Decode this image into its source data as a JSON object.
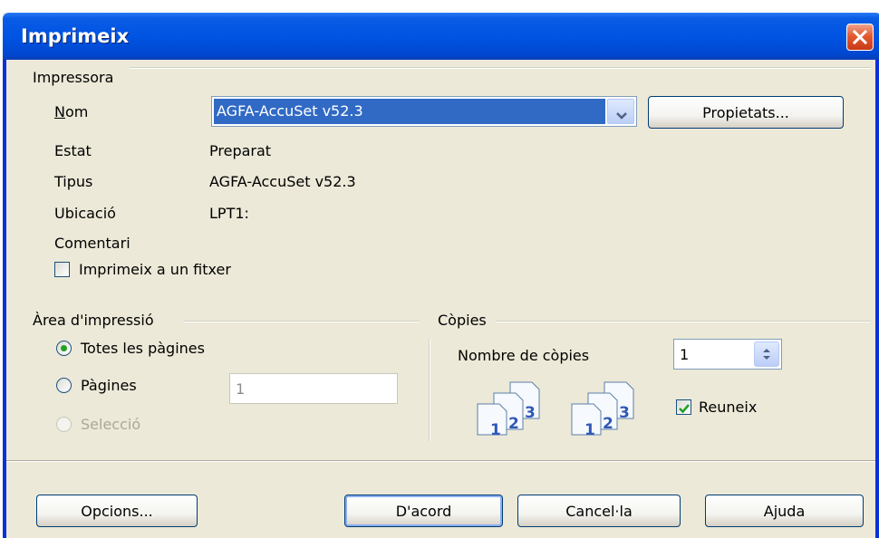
{
  "window": {
    "title": "Imprimeix",
    "close_icon": "close-icon"
  },
  "printer": {
    "group_label": "Impressora",
    "name_label": "Nom",
    "name_value": "AGFA-AccuSet v52.3",
    "properties_button": "Propietats...",
    "rows": [
      {
        "label": "Estat",
        "value": "Preparat"
      },
      {
        "label": "Tipus",
        "value": "AGFA-AccuSet v52.3"
      },
      {
        "label": "Ubicació",
        "value": "LPT1:"
      },
      {
        "label": "Comentari",
        "value": ""
      }
    ],
    "print_to_file_label": "Imprimeix a un fitxer",
    "print_to_file_checked": false
  },
  "print_area": {
    "group_label": "Àrea d'impressió",
    "all_pages_label": "Totes les pàgines",
    "pages_label": "Pàgines",
    "pages_value": "1",
    "selection_label": "Selecció",
    "selected": "all_pages"
  },
  "copies": {
    "group_label": "Còpies",
    "count_label": "Nombre de còpies",
    "count_value": "1",
    "collate_label": "Reuneix",
    "collate_checked": true
  },
  "buttons": {
    "options": "Opcions...",
    "ok": "D'acord",
    "cancel": "Cancel·la",
    "help": "Ajuda"
  },
  "colors": {
    "titlebar": "#0054e3",
    "dialog_bg": "#ece9d8",
    "selection": "#316ac5",
    "radio_dot": "#21a121"
  }
}
